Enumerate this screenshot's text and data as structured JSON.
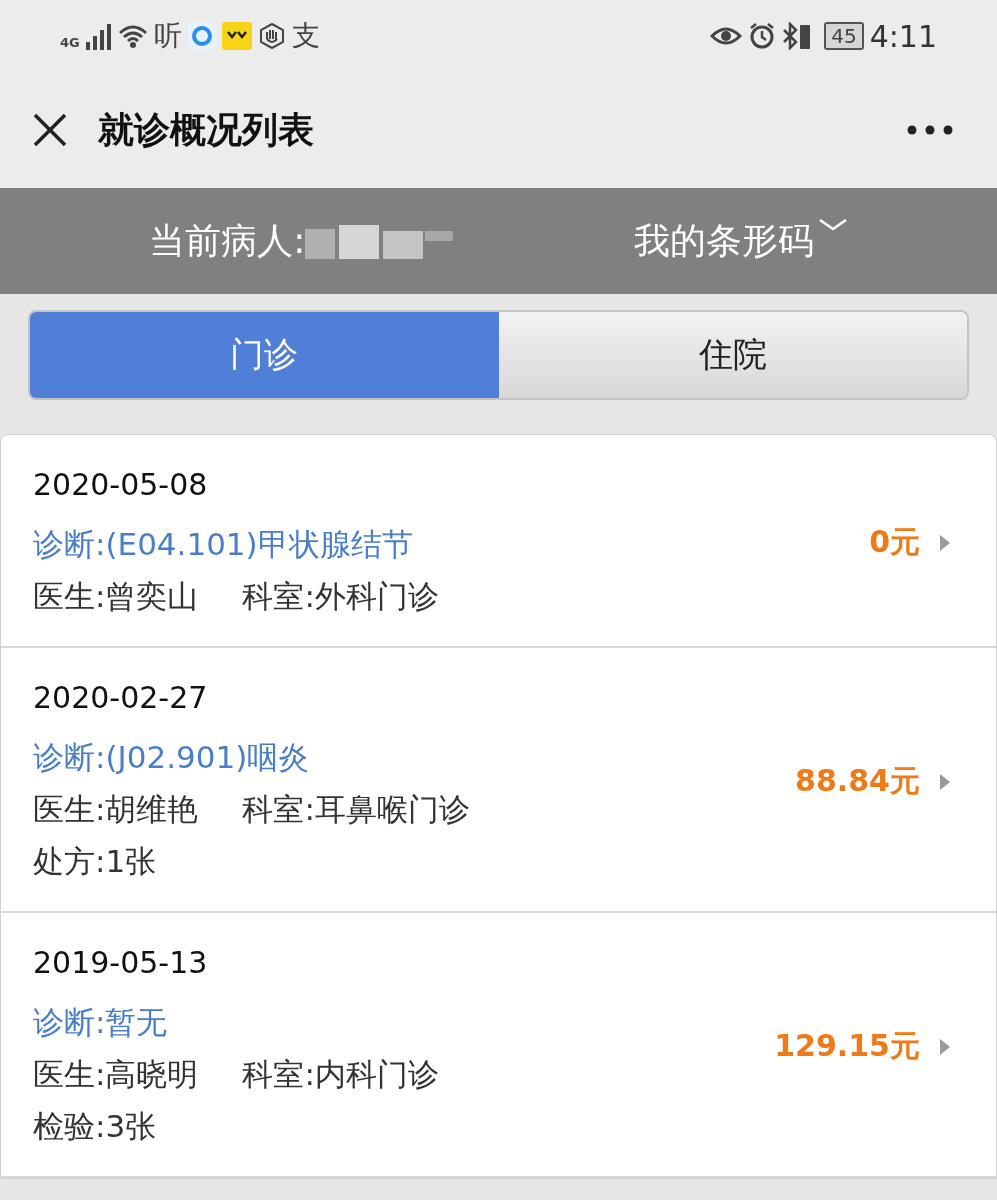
{
  "status_bar": {
    "network": "4G",
    "app_glyph_1": "听",
    "app_glyph_2": "支",
    "battery": "45",
    "time": "4:11"
  },
  "header": {
    "title": "就诊概况列表"
  },
  "patient_bar": {
    "patient_label": "当前病人:",
    "barcode_label": "我的条形码"
  },
  "tabs": [
    {
      "label": "门诊",
      "selected": true
    },
    {
      "label": "住院",
      "selected": false
    }
  ],
  "visits": [
    {
      "date": "2020-05-08",
      "diagnosis": "诊断:(E04.101)甲状腺结节",
      "doctor": "医生:曾奕山",
      "department": "科室:外科门诊",
      "amount": "0元"
    },
    {
      "date": "2020-02-27",
      "diagnosis": "诊断:(J02.901)咽炎",
      "doctor": "医生:胡维艳",
      "department": "科室:耳鼻喉门诊",
      "extra": "处方:1张",
      "amount": "88.84元"
    },
    {
      "date": "2019-05-13",
      "diagnosis": "诊断:暂无",
      "doctor": "医生:高晓明",
      "department": "科室:内科门诊",
      "extra": "检验:3张",
      "amount": "129.15元"
    }
  ]
}
